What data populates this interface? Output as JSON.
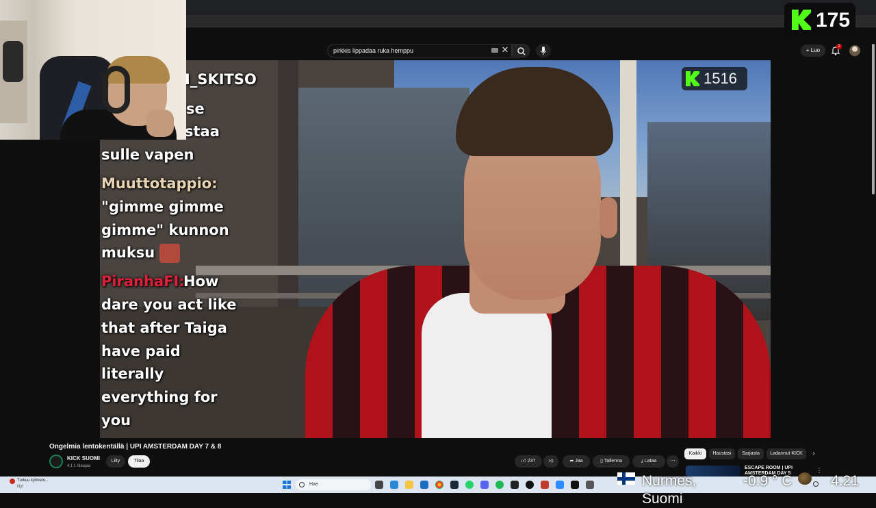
{
  "browser": {
    "search_query": "pirkkis lippadaa ruka hemppu",
    "clear_symbol": "✕"
  },
  "header": {
    "create_label": "+ Luo",
    "notification_count": "2"
  },
  "kick": {
    "top_viewer_count": "175",
    "video_viewer_count": "1516",
    "brand_color": "#53fc18"
  },
  "chat": {
    "lines": [
      "I_SKITSO",
      "se",
      "staa",
      "sulle vapen"
    ],
    "messages": [
      {
        "user": "Muuttotappio:",
        "lines": [
          "\"gimme gimme",
          "gimme\" kunnon",
          "muksu"
        ]
      },
      {
        "user": "PiranhaFI:",
        "lines": [
          "How",
          "dare you act like",
          "that after Taiga",
          "have paid",
          "literally",
          "everything for",
          "you"
        ]
      }
    ]
  },
  "video": {
    "title": "Ongelmia lentokentällä | UPI AMSTERDAM DAY 7 & 8",
    "channel_name": "KICK SUOMI",
    "channel_subs": "4,1 t. tilaajaa",
    "join_label": "Liity",
    "subscribe_label": "Tilaa",
    "like_label": "237",
    "share_label": "Jaa",
    "save_label": "Tallenna",
    "download_label": "Lataa",
    "more_label": "⋯"
  },
  "recommendations": {
    "chips": [
      "Kaikki",
      "Haustasi",
      "Sarjasta",
      "Ladannut KICK"
    ],
    "next_symbol": "›",
    "first_title": "ESCAPE ROOM | UPI AMSTERDAM DAY 5",
    "more_symbol": "⋮"
  },
  "taskbar": {
    "notification_title": "Turkuu kylmem...",
    "notification_sub": "Nyt",
    "search_placeholder": "Hae",
    "weather_location": "Nurmes, Suomi",
    "weather_temp": "-0.9 ° C",
    "clock": "4.21"
  }
}
